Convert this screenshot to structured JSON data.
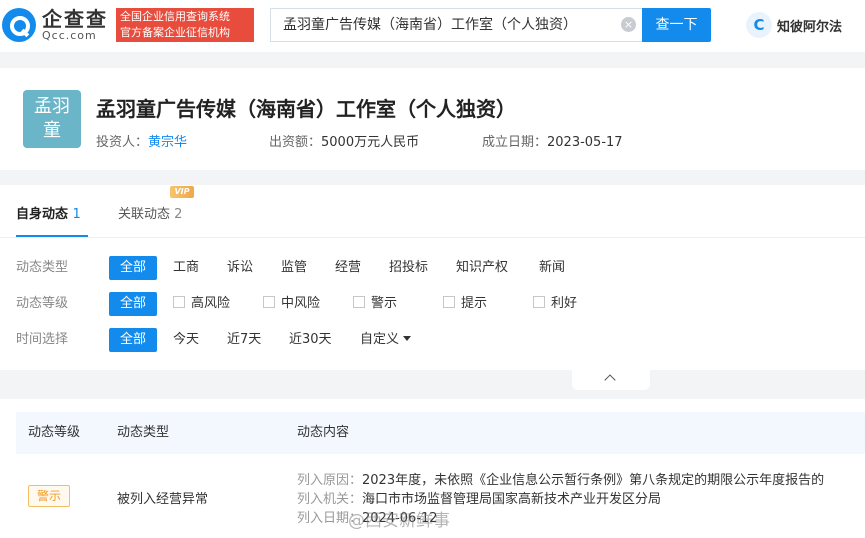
{
  "header": {
    "logo_cn": "企查查",
    "logo_en": "Qcc.com",
    "slogan_line1": "全国企业信用查询系统",
    "slogan_line2": "官方备案企业征信机构",
    "search_value": "孟羽童广告传媒（海南省）工作室（个人独资）",
    "search_button": "查一下",
    "brand_icon_text": "C",
    "brand_label": "知彼阿尔法"
  },
  "company": {
    "avatar_line1": "孟羽",
    "avatar_line2": "童",
    "name": "孟羽童广告传媒（海南省）工作室（个人独资）",
    "investor_label": "投资人：",
    "investor_value": "黄宗华",
    "capital_label": "出资额：",
    "capital_value": "5000万元人民币",
    "date_label": "成立日期：",
    "date_value": "2023-05-17"
  },
  "tabs": [
    {
      "label": "自身动态",
      "count": "1"
    },
    {
      "label": "关联动态",
      "count": "2",
      "badge": "VIP"
    }
  ],
  "filters": {
    "type": {
      "label": "动态类型",
      "options": [
        "全部",
        "工商",
        "诉讼",
        "监管",
        "经营",
        "招投标",
        "知识产权",
        "新闻"
      ]
    },
    "level": {
      "label": "动态等级",
      "options": [
        "全部",
        "高风险",
        "中风险",
        "警示",
        "提示",
        "利好"
      ]
    },
    "time": {
      "label": "时间选择",
      "options": [
        "全部",
        "今天",
        "近7天",
        "近30天",
        "自定义"
      ]
    }
  },
  "table": {
    "headers": [
      "动态等级",
      "动态类型",
      "动态内容"
    ],
    "rows": [
      {
        "level": "警示",
        "type": "被列入经营异常",
        "reason_label": "列入原因：",
        "reason": "2023年度，未依照《企业信息公示暂行条例》第八条规定的期限公示年度报告的",
        "authority_label": "列入机关：",
        "authority": "海口市市场监督管理局国家高新技术产业开发区分局",
        "date_label": "列入日期：",
        "date": "2024-06-12"
      }
    ]
  },
  "watermark": "@西安新鲜事",
  "colors": {
    "accent": "#128bed",
    "warning": "#ef9d23",
    "slogan_bg": "#e74c3c"
  }
}
